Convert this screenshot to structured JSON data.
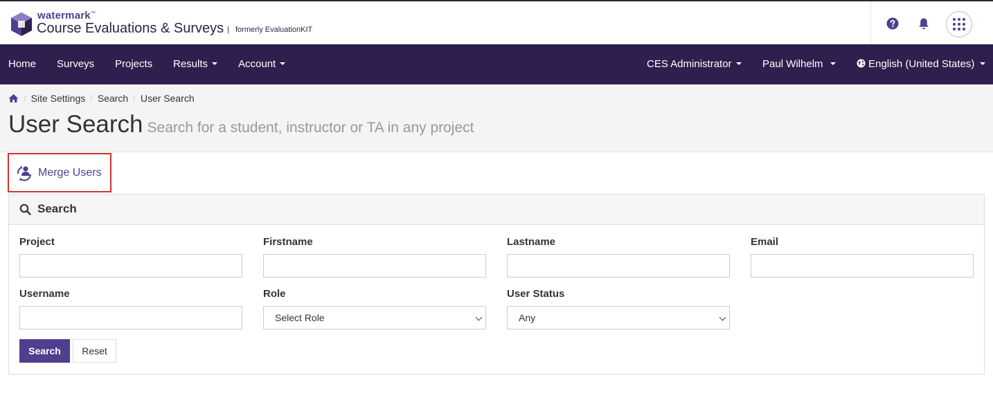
{
  "header": {
    "brand_small": "watermark",
    "brand_tm": "™",
    "brand_main": "Course Evaluations & Surveys",
    "brand_separator": "|",
    "brand_formerly": "formerly EvaluationKIT",
    "icons": [
      "help-icon",
      "bell-icon",
      "apps-grid-icon"
    ]
  },
  "nav": {
    "left": [
      {
        "label": "Home",
        "dropdown": false
      },
      {
        "label": "Surveys",
        "dropdown": false
      },
      {
        "label": "Projects",
        "dropdown": false
      },
      {
        "label": "Results",
        "dropdown": true
      },
      {
        "label": "Account",
        "dropdown": true
      }
    ],
    "role": "CES Administrator",
    "user": "Paul Wilhelm",
    "language": "English (United States)"
  },
  "breadcrumb": [
    "Site Settings",
    "Search",
    "User Search"
  ],
  "page": {
    "title": "User Search",
    "subtitle": "Search for a student, instructor or TA in any project"
  },
  "merge_link": "Merge Users",
  "search_panel": {
    "title": "Search",
    "fields": {
      "project": {
        "label": "Project",
        "value": ""
      },
      "firstname": {
        "label": "Firstname",
        "value": ""
      },
      "lastname": {
        "label": "Lastname",
        "value": ""
      },
      "email": {
        "label": "Email",
        "value": ""
      },
      "username": {
        "label": "Username",
        "value": ""
      },
      "role": {
        "label": "Role",
        "selected": "Select Role"
      },
      "user_status": {
        "label": "User Status",
        "selected": "Any"
      }
    },
    "search_button": "Search",
    "reset_button": "Reset"
  },
  "colors": {
    "nav_bg": "#2f1f4e",
    "brand_purple": "#4f3f8e",
    "highlight_red": "#d0302f"
  }
}
